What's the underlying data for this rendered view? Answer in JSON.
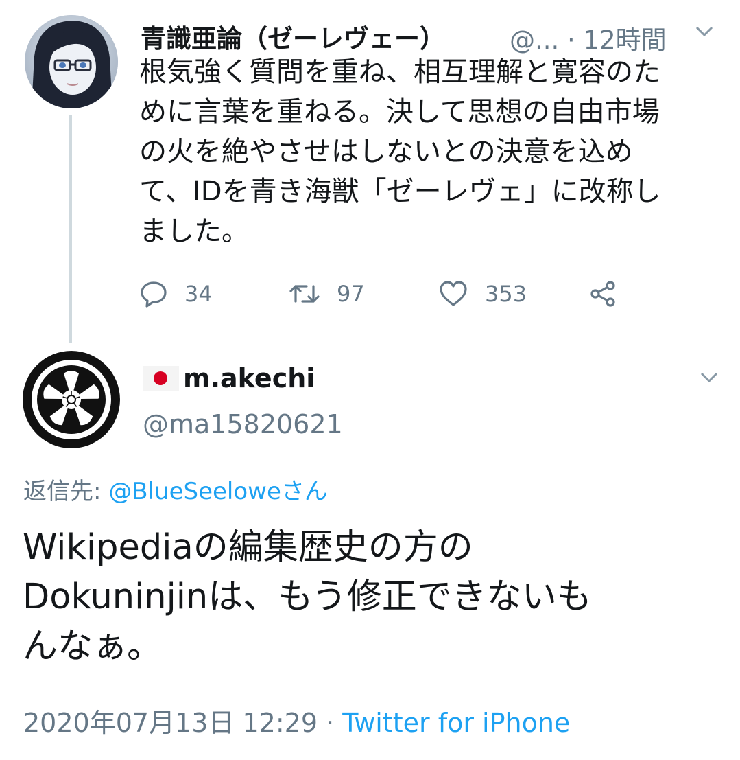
{
  "parent_tweet": {
    "display_name": "青識亜論（ゼーレヴェー）",
    "handle_time": "@... · 12時間",
    "text_lines": [
      "根気強く質問を重ね、相互理解と寛容のた",
      "めに言葉を重ねる。決して思想の自由市場",
      "の火を絶やさせはしないとの決意を込め",
      "て、IDを青き海獣「ゼーレヴェ」に改称し",
      "ました。"
    ],
    "reply_count": "34",
    "retweet_count": "97",
    "like_count": "353",
    "icons": [
      "reply-icon",
      "retweet-icon",
      "like-icon",
      "share-icon",
      "chevron-down-icon"
    ]
  },
  "reply_tweet": {
    "display_name": "m.akechi",
    "flag_icon": "japan-flag-icon",
    "handle": "@ma15820621",
    "reply_label": "返信先: ",
    "reply_target": "@BlueSeeloweさん",
    "text_lines": [
      "Wikipediaの編集歴史の方の",
      "Dokuninjinは、もう修正できないも",
      "んなぁ。"
    ],
    "date_time": "2020年07月13日 12:29",
    "separator": " · ",
    "source": "Twitter for iPhone"
  },
  "colors": {
    "text": "#14171a",
    "secondary": "#657786",
    "link": "#1da1f2",
    "thread_line": "#cfd9de",
    "flag_red": "#d70022"
  }
}
